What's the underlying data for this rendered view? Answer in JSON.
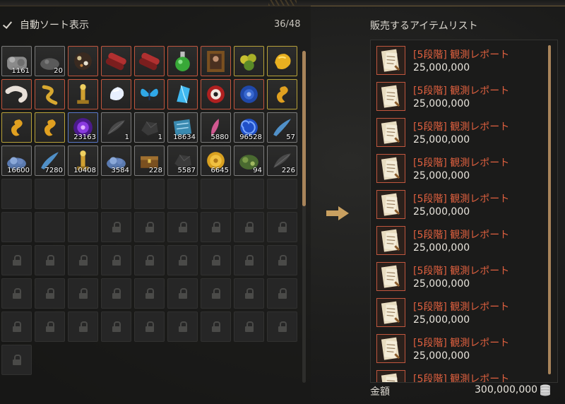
{
  "inventory": {
    "auto_sort_label": "自動ソート表示",
    "slot_count": "36/48",
    "items": [
      {
        "icon": "ore-pile",
        "qty": "1161",
        "border": "#7a7a7a"
      },
      {
        "icon": "dust-pile",
        "qty": "20",
        "border": "#7a7a7a"
      },
      {
        "icon": "mixed-ore",
        "qty": "",
        "border": "#c0563e"
      },
      {
        "icon": "red-scroll",
        "qty": "",
        "border": "#c0563e"
      },
      {
        "icon": "red-scroll",
        "qty": "",
        "border": "#c0563e"
      },
      {
        "icon": "green-potion",
        "qty": "",
        "border": "#c0563e"
      },
      {
        "icon": "portrait-frame",
        "qty": "",
        "border": "#c0563e"
      },
      {
        "icon": "golden-herb",
        "qty": "",
        "border": "#b8a23a"
      },
      {
        "icon": "gold-nugget",
        "qty": "",
        "border": "#b8a23a"
      },
      {
        "icon": "white-worm",
        "qty": "",
        "border": "#c0563e"
      },
      {
        "icon": "golden-dragon",
        "qty": "",
        "border": "#c0563e"
      },
      {
        "icon": "golden-statue",
        "qty": "",
        "border": "#c0563e"
      },
      {
        "icon": "white-gem",
        "qty": "",
        "border": "#c0563e"
      },
      {
        "icon": "blue-butterfly",
        "qty": "",
        "border": "#c0563e"
      },
      {
        "icon": "blue-crystal",
        "qty": "",
        "border": "#c0563e"
      },
      {
        "icon": "red-emblem",
        "qty": "",
        "border": "#c0563e"
      },
      {
        "icon": "blue-orb",
        "qty": "",
        "border": "#c0563e"
      },
      {
        "icon": "golden-seahorse",
        "qty": "",
        "border": "#b8a23a"
      },
      {
        "icon": "golden-seahorse",
        "qty": "",
        "border": "#b8a23a"
      },
      {
        "icon": "golden-seahorse",
        "qty": "",
        "border": "#b8a23a"
      },
      {
        "icon": "purple-vortex",
        "qty": "23163",
        "border": "#5a78c8"
      },
      {
        "icon": "dark-feather",
        "qty": "1",
        "border": "#7a7a7a"
      },
      {
        "icon": "dark-stone",
        "qty": "1",
        "border": "#7a7a7a"
      },
      {
        "icon": "blue-map",
        "qty": "18634",
        "border": "#7a7a7a"
      },
      {
        "icon": "pink-feather",
        "qty": "5880",
        "border": "#7a7a7a"
      },
      {
        "icon": "blue-swirl",
        "qty": "96528",
        "border": "#7a7a7a"
      },
      {
        "icon": "blue-horn",
        "qty": "57",
        "border": "#7a7a7a"
      },
      {
        "icon": "blue-ore",
        "qty": "16600",
        "border": "#7a7a7a"
      },
      {
        "icon": "blue-horn",
        "qty": "7280",
        "border": "#7a7a7a"
      },
      {
        "icon": "golden-statue",
        "qty": "10408",
        "border": "#7a7a7a"
      },
      {
        "icon": "blue-ore",
        "qty": "3584",
        "border": "#7a7a7a"
      },
      {
        "icon": "treasure-chest",
        "qty": "228",
        "border": "#7a7a7a"
      },
      {
        "icon": "dark-stone",
        "qty": "5587",
        "border": "#7a7a7a"
      },
      {
        "icon": "gold-coin",
        "qty": "6645",
        "border": "#7a7a7a"
      },
      {
        "icon": "green-moss",
        "qty": "94",
        "border": "#7a7a7a"
      },
      {
        "icon": "dark-feather",
        "qty": "226",
        "border": "#7a7a7a"
      }
    ],
    "empty_slots": 12,
    "locked_slots": 34
  },
  "sell": {
    "title": "販売するアイテムリスト",
    "items": [
      {
        "name": "[5段階] 観測レポート",
        "price": "25,000,000"
      },
      {
        "name": "[5段階] 観測レポート",
        "price": "25,000,000"
      },
      {
        "name": "[5段階] 観測レポート",
        "price": "25,000,000"
      },
      {
        "name": "[5段階] 観測レポート",
        "price": "25,000,000"
      },
      {
        "name": "[5段階] 観測レポート",
        "price": "25,000,000"
      },
      {
        "name": "[5段階] 観測レポート",
        "price": "25,000,000"
      },
      {
        "name": "[5段階] 観測レポート",
        "price": "25,000,000"
      },
      {
        "name": "[5段階] 観測レポート",
        "price": "25,000,000"
      },
      {
        "name": "[5段階] 観測レポート",
        "price": "25,000,000"
      },
      {
        "name": "[5段階] 観測レポート",
        "price": "25,000,000"
      }
    ],
    "total_label": "金額",
    "total_value": "300,000,000"
  },
  "colors": {
    "accent_gold": "#a8845a",
    "item_name": "#e0603f"
  }
}
